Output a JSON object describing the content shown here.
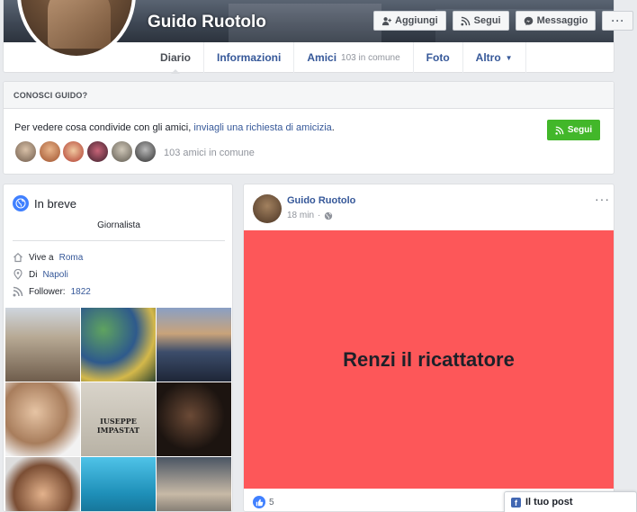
{
  "profile": {
    "name": "Guido Ruotolo",
    "actions": {
      "add_friend": "Aggiungi",
      "follow": "Segui",
      "message": "Messaggio",
      "more": "···"
    },
    "tabs": [
      {
        "label": "Diario",
        "sub": ""
      },
      {
        "label": "Informazioni",
        "sub": ""
      },
      {
        "label": "Amici",
        "sub": "103 in comune"
      },
      {
        "label": "Foto",
        "sub": ""
      },
      {
        "label": "Altro",
        "sub": ""
      }
    ]
  },
  "conosci": {
    "heading": "CONOSCI GUIDO?",
    "text_before": "Per vedere cosa condivide con gli amici, ",
    "link": "inviagli una richiesta di amicizia",
    "text_after": ".",
    "follow_button": "Segui",
    "mutual_friends": "103 amici in comune"
  },
  "intro": {
    "title": "In breve",
    "bio": "Giornalista",
    "lives_prefix": "Vive a",
    "lives_city": "Roma",
    "from_prefix": "Di",
    "from_city": "Napoli",
    "followers_prefix": "Follower:",
    "followers_count": "1822",
    "photo_text": "IUSEPPE IMPASTAT"
  },
  "post": {
    "author": "Guido Ruotolo",
    "time": "18 min",
    "dots": "···",
    "text": "Renzi il ricattatore",
    "likes": "5",
    "banner_color": "#fd5759"
  },
  "chat": {
    "label": "Il tuo post"
  },
  "colors": {
    "link": "#365899",
    "green": "#42b72a",
    "fb_blue": "#4267b2"
  }
}
